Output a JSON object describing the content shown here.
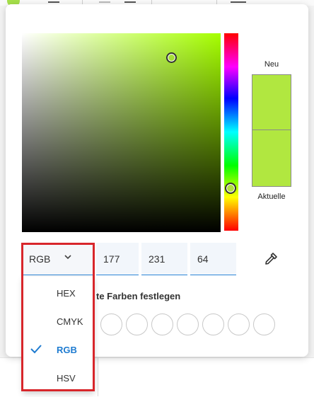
{
  "color_picker": {
    "new_label": "Neu",
    "current_label": "Aktuelle",
    "new_color": "#b1e740",
    "current_color": "#b1e740",
    "mode": "RGB",
    "values": [
      "177",
      "231",
      "64"
    ],
    "custom_colors_label": "te Farben festlegen"
  },
  "dropdown": {
    "items": [
      {
        "label": "HEX",
        "selected": false
      },
      {
        "label": "CMYK",
        "selected": false
      },
      {
        "label": "RGB",
        "selected": true
      },
      {
        "label": "HSV",
        "selected": false
      }
    ]
  },
  "colors": {
    "accent": "#2d86d6",
    "highlight": "#d8262b",
    "selected_text": "#1e7bd0"
  },
  "icons": {
    "chevron": "chevron-down-icon",
    "eyedropper": "eyedropper-icon",
    "check": "check-icon"
  }
}
